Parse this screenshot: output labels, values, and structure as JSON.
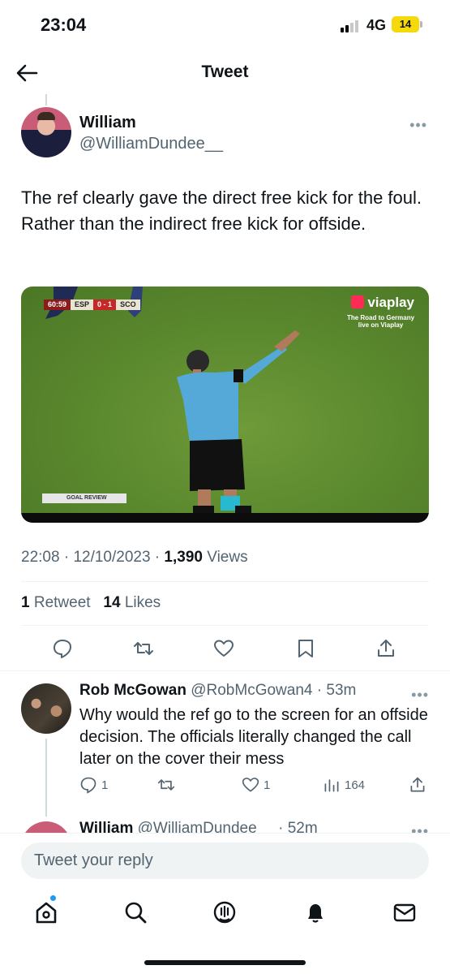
{
  "status_bar": {
    "time": "23:04",
    "network": "4G",
    "battery": "14"
  },
  "header": {
    "title": "Tweet"
  },
  "tweet": {
    "author_name": "William",
    "author_handle": "@WilliamDundee__",
    "text": "The ref clearly gave the direct free kick for the foul. Rather than the indirect free kick for offside.",
    "media": {
      "scorebug": {
        "time": "60:59",
        "home": "ESP",
        "score": "0 - 1",
        "away": "SCO"
      },
      "broadcaster": "viaplay",
      "tagline": "The Road to Germany live on Viaplay",
      "overlay": "GOAL REVIEW"
    },
    "time": "22:08",
    "date": "12/10/2023",
    "views_count": "1,390",
    "views_label": "Views",
    "retweets_count": "1",
    "retweets_label": "Retweet",
    "likes_count": "14",
    "likes_label": "Likes"
  },
  "reply": {
    "author_name": "Rob McGowan",
    "author_handle": "@RobMcGowan4",
    "age": "53m",
    "text": "Why would the ref go to the screen for an offside decision. The officials literally changed the call later on the cover their mess",
    "reply_count": "1",
    "like_count": "1",
    "view_count": "164"
  },
  "next_reply": {
    "author_name": "William",
    "author_handle": "@WilliamDundee__",
    "age": "52m"
  },
  "composer": {
    "placeholder": "Tweet your reply"
  },
  "colors": {
    "accent": "#1d9bf0",
    "text": "#0f1419",
    "secondary": "#536471"
  },
  "icons": [
    "back-arrow-icon",
    "more-icon",
    "reply-icon",
    "retweet-icon",
    "like-icon",
    "bookmark-icon",
    "share-icon",
    "views-icon",
    "home-icon",
    "search-icon",
    "spaces-icon",
    "notifications-icon",
    "messages-icon"
  ]
}
